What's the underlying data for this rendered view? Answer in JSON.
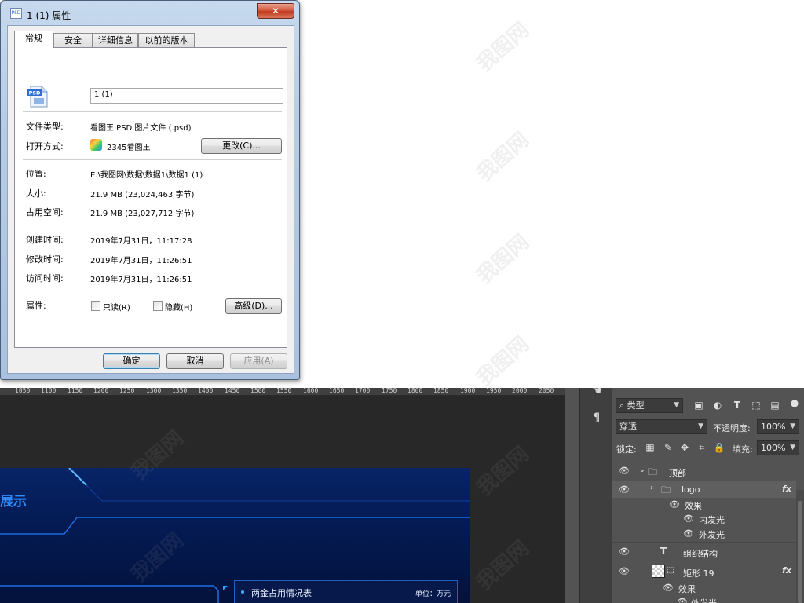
{
  "dialog": {
    "title": "1 (1) 属性",
    "close_label": "✕",
    "icon_text": "PSD",
    "tabs": [
      "常规",
      "安全",
      "详细信息",
      "以前的版本"
    ],
    "file_name": "1 (1)",
    "file_icon_label": "PSD",
    "rows": {
      "type_label": "文件类型:",
      "type_value": "看图王 PSD 图片文件 (.psd)",
      "open_label": "打开方式:",
      "open_value": "2345看图王",
      "change_button": "更改(C)...",
      "location_label": "位置:",
      "location_value": "E:\\我图网\\数据\\数据1\\数据1 (1)",
      "size_label": "大小:",
      "size_value": "21.9 MB (23,024,463 字节)",
      "disk_label": "占用空间:",
      "disk_value": "21.9 MB (23,027,712 字节)",
      "created_label": "创建时间:",
      "created_value": "2019年7月31日，11:17:28",
      "modified_label": "修改时间:",
      "modified_value": "2019年7月31日，11:26:51",
      "accessed_label": "访问时间:",
      "accessed_value": "2019年7月31日，11:26:51",
      "attr_label": "属性:",
      "readonly_label": "只读(R)",
      "hidden_label": "隐藏(H)",
      "advanced_button": "高级(D)..."
    },
    "buttons": {
      "ok": "确定",
      "cancel": "取消",
      "apply": "应用(A)"
    }
  },
  "photoshop": {
    "ruler_ticks": [
      "1050",
      "1100",
      "1150",
      "1200",
      "1250",
      "1300",
      "1350",
      "1400",
      "1450",
      "1500",
      "1550",
      "1600",
      "1650",
      "1700",
      "1750",
      "1800",
      "1850",
      "1900",
      "1950",
      "2000",
      "2050"
    ],
    "canvas": {
      "title": "展示",
      "card_title": "两金占用情况表",
      "card_unit": "单位：万元"
    },
    "layers_panel": {
      "filter_label": "类型",
      "blend_mode": "穿透",
      "opacity_label": "不透明度:",
      "opacity_value": "100%",
      "lock_label": "锁定:",
      "fill_label": "填充:",
      "fill_value": "100%",
      "layers": [
        {
          "name": "顶部",
          "type": "group",
          "fx": ""
        },
        {
          "name": "logo",
          "type": "group",
          "fx": "fx"
        },
        {
          "name": "效果",
          "type": "effect",
          "fx": ""
        },
        {
          "name": "内发光",
          "type": "effect",
          "fx": ""
        },
        {
          "name": "外发光",
          "type": "effect",
          "fx": ""
        },
        {
          "name": "组织结构",
          "type": "text",
          "fx": ""
        },
        {
          "name": "矩形 19",
          "type": "shape",
          "fx": "fx"
        },
        {
          "name": "效果",
          "type": "effect",
          "fx": ""
        },
        {
          "name": "外发光",
          "type": "effect",
          "fx": ""
        }
      ]
    }
  },
  "watermark_text": "我图网"
}
